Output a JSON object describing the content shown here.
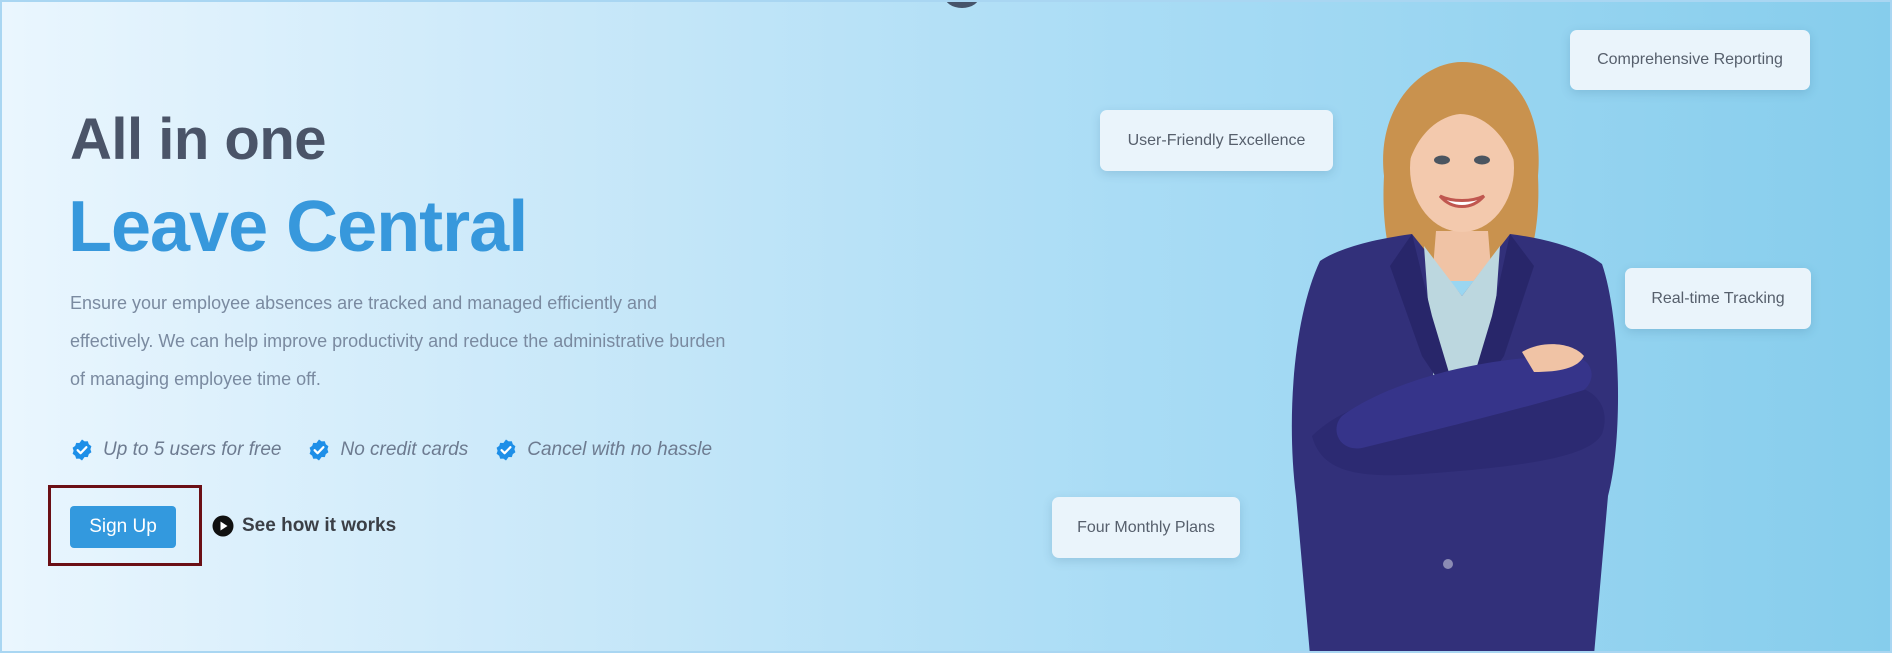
{
  "hero": {
    "title_line1": "All in one",
    "title_line2": "Leave Central",
    "description": "Ensure your employee absences are tracked and managed efficiently and effectively. We can help improve productivity and reduce the administrative burden of managing employee time off.",
    "features": [
      {
        "label": "Up to 5 users for free",
        "icon": "verified-check-icon"
      },
      {
        "label": "No credit cards",
        "icon": "verified-check-icon"
      },
      {
        "label": "Cancel with no hassle",
        "icon": "verified-check-icon"
      }
    ],
    "signup_label": "Sign Up",
    "how_label": "See how it works",
    "how_icon": "play-circle-icon"
  },
  "cards": {
    "user_friendly": "User-Friendly Excellence",
    "reporting": "Comprehensive Reporting",
    "tracking": "Real-time Tracking",
    "plans": "Four Monthly Plans"
  },
  "colors": {
    "accent": "#3798dc",
    "heading": "#4a5468",
    "button": "#3399de",
    "highlight_frame": "#6b0f15",
    "suit": "#32307a"
  }
}
